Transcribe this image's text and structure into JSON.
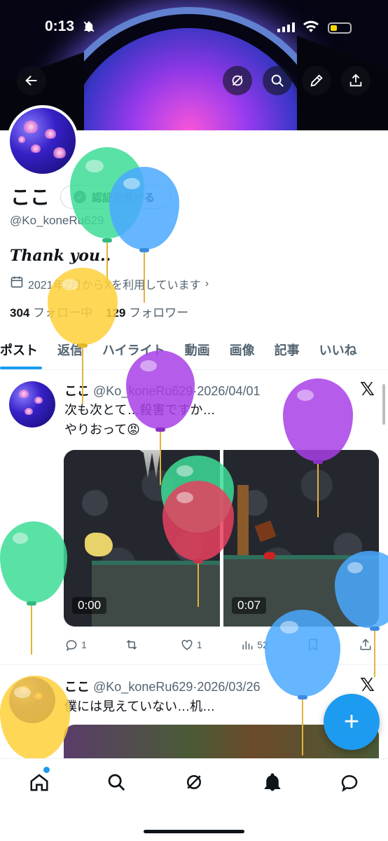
{
  "status_bar": {
    "time": "0:13",
    "battery_color": "#ffd60a"
  },
  "header": {
    "icons": [
      "back-arrow-icon",
      "grok-icon",
      "search-icon",
      "pencil-icon",
      "share-icon"
    ]
  },
  "profile": {
    "name": "ここ",
    "verify_label": "認証を受ける",
    "handle": "@Ko_koneRu629",
    "bio": "Thank you..",
    "joined": "2021年2月からXを利用しています",
    "following_count": "304",
    "following_label": "フォロー中",
    "followers_count": "129",
    "followers_label": "フォロワー"
  },
  "tabs": [
    {
      "label": "ポスト",
      "active": true
    },
    {
      "label": "返信"
    },
    {
      "label": "ハイライト"
    },
    {
      "label": "動画"
    },
    {
      "label": "画像"
    },
    {
      "label": "記事"
    },
    {
      "label": "いいね"
    }
  ],
  "posts": [
    {
      "name": "ここ",
      "handle": "@Ko_koneRu629",
      "sep": "·",
      "date": "2026/04/01",
      "text_line1": "次も次とて…殺害ですか…",
      "text_line2": "やりおって",
      "emoji": "😡",
      "video1_duration": "0:00",
      "video2_duration": "0:07",
      "replies": "1",
      "reposts": "",
      "likes": "1",
      "views": "52"
    },
    {
      "name": "ここ",
      "handle": "@Ko_koneRu629",
      "sep": "·",
      "date": "2026/03/26",
      "text_line1": "僕には見えていない…机…"
    }
  ],
  "fab": {
    "label": "+"
  },
  "accent_color": "#1d9bf0"
}
